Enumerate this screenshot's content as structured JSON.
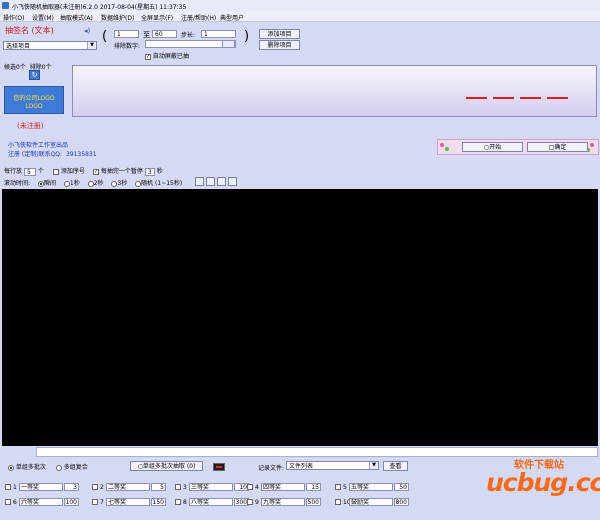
{
  "window": {
    "title": "小飞侠随机抽取器(未注册)6.2.0 2017-08-04(星期五) 11:37:35"
  },
  "menu": [
    "操作(O)",
    "设置(M)",
    "抽取模式(A)",
    "数据维护(D)",
    "全屏显示(F)",
    "注册/帮助(H)",
    "典型用户"
  ],
  "project": {
    "label": "抽签名 (文本)",
    "select_value": "选择项目"
  },
  "range": {
    "from": "1",
    "to_label": "至",
    "to": "60",
    "step_label": "步长:",
    "step": "1",
    "exclude_label": "排除数字:",
    "exclude_value": ""
  },
  "buttons": {
    "add_project": "添加项目",
    "delete_project": "删除项目",
    "start": "○开始",
    "confirm": "□确定",
    "single_batch": "○单组多批次抽取 (0)",
    "view": "查看"
  },
  "auto_clear": {
    "label": "自动屏蔽已抽",
    "checked": true
  },
  "counts": {
    "selected": "候选0个",
    "drawn": "排除0个"
  },
  "logo": {
    "line1": "您的公司LOGO",
    "line2": "LOGO"
  },
  "unregistered": "(未注册)",
  "studio": {
    "name": "小飞侠软件工作室出品",
    "contact_label": "注册 (定制)联系QQ:",
    "contact_value": "39135831"
  },
  "options": {
    "per_row_label": "每行放",
    "per_row_value": "5",
    "per_row_unit": "个",
    "add_seq_label": "添加序号",
    "add_seq_checked": false,
    "pause_label": "每抽完一个暂停",
    "pause_checked": true,
    "pause_value": "3",
    "pause_unit": "秒"
  },
  "scroll": {
    "label": "滚动时间:",
    "modes": [
      "瞬间",
      "1秒",
      "2秒",
      "3秒",
      "随机 (1~15秒)"
    ],
    "selected": 0
  },
  "bottom": {
    "mode1": "单组多批次",
    "mode2": "多组复合",
    "record_label": "记录文件:",
    "record_value": "文件列表"
  },
  "prizes": [
    {
      "no": "1",
      "name": "一等奖",
      "count": "3"
    },
    {
      "no": "2",
      "name": "二等奖",
      "count": "5"
    },
    {
      "no": "3",
      "name": "三等奖",
      "count": "10"
    },
    {
      "no": "4",
      "name": "四等奖",
      "count": "15"
    },
    {
      "no": "5",
      "name": "五等奖",
      "count": "50"
    },
    {
      "no": "6",
      "name": "六等奖",
      "count": "100"
    },
    {
      "no": "7",
      "name": "七等奖",
      "count": "150"
    },
    {
      "no": "8",
      "name": "八等奖",
      "count": "300"
    },
    {
      "no": "9",
      "name": "九等奖",
      "count": "500"
    },
    {
      "no": "10",
      "name": "鼓励奖",
      "count": "800"
    }
  ],
  "watermark": {
    "site": "ucbug.cc",
    "tagline": "软件下载站"
  },
  "colors": {
    "accent_red": "#d31d1d",
    "link_blue": "#1437c7",
    "display_bg": "#e4ddf6",
    "window_bg": "#d6d9f3"
  }
}
